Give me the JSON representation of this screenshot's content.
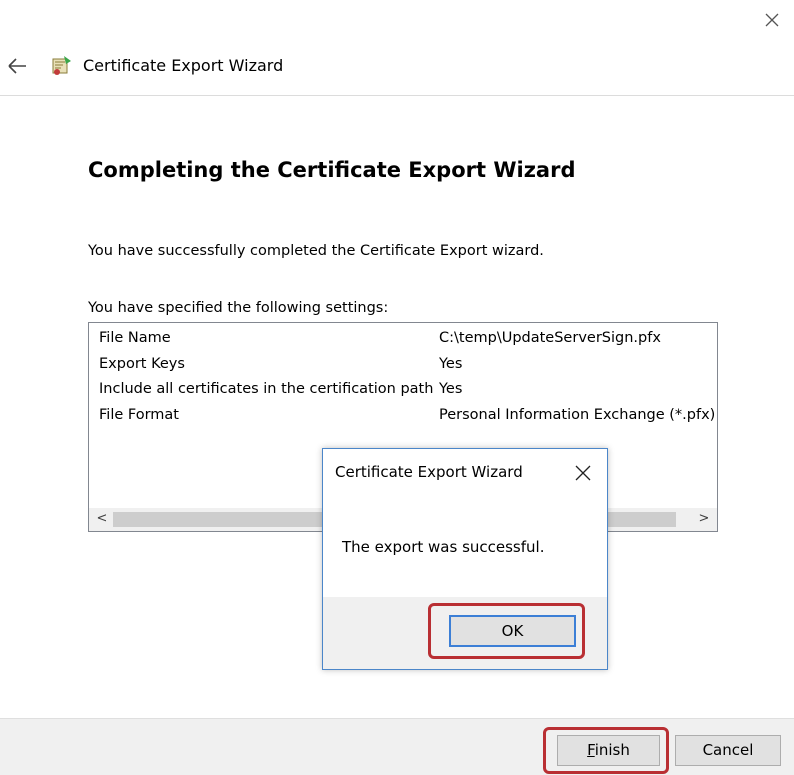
{
  "window": {
    "title": "Certificate Export Wizard",
    "close_icon": "close-icon",
    "back_icon": "back-arrow-icon",
    "app_icon": "certificate-icon"
  },
  "main": {
    "heading": "Completing the Certificate Export Wizard",
    "success_text": "You have successfully completed the Certificate Export wizard.",
    "settings_label": "You have specified the following settings:",
    "settings": [
      {
        "key": "File Name",
        "value": "C:\\temp\\UpdateServerSign.pfx"
      },
      {
        "key": "Export Keys",
        "value": "Yes"
      },
      {
        "key": "Include all certificates in the certification path",
        "value": "Yes"
      },
      {
        "key": "File Format",
        "value": "Personal Information Exchange (*.pfx)"
      }
    ],
    "scroll_left": "<",
    "scroll_right": ">"
  },
  "footer": {
    "finish_label": "Finish",
    "cancel_label": "Cancel"
  },
  "dialog": {
    "title": "Certificate Export Wizard",
    "message": "The export was successful.",
    "ok_label": "OK"
  },
  "colors": {
    "highlight": "#b92f33",
    "dialog_border": "#4b86c9",
    "footer_bg": "#f0f0f0"
  }
}
